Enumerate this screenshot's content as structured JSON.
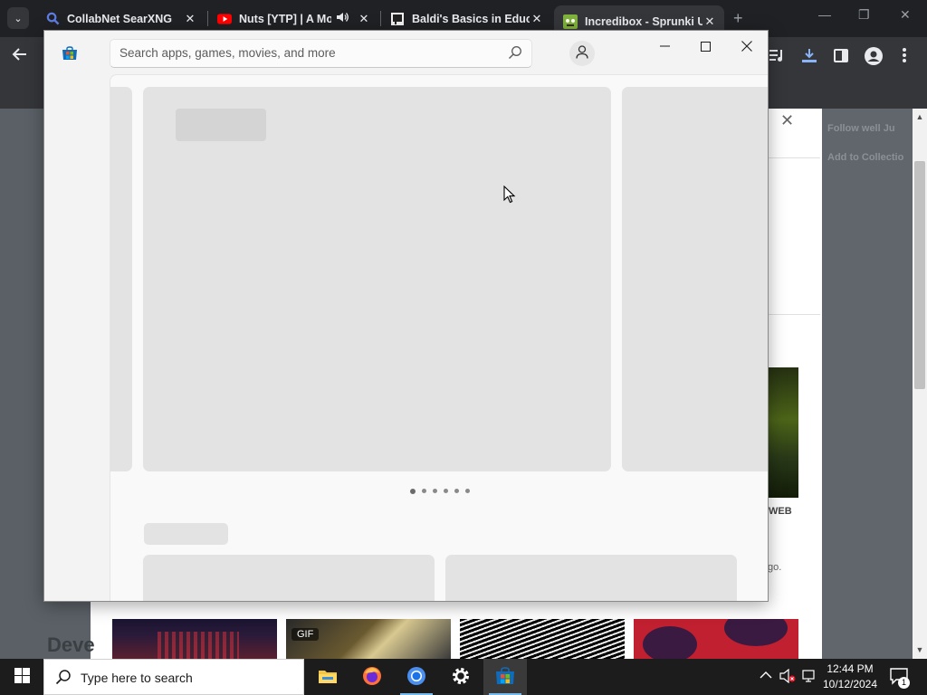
{
  "browser": {
    "tabs": [
      {
        "title": "CollabNet SearXNG",
        "favicon": "search-icon",
        "active": false
      },
      {
        "title": "Nuts [YTP] | A Mo",
        "favicon": "youtube-icon",
        "active": false,
        "audio": true
      },
      {
        "title": "Baldi's Basics in Educ",
        "favicon": "game-icon",
        "active": false
      },
      {
        "title": "Incredibox - Sprunki U",
        "favicon": "sprunki-icon",
        "active": true
      }
    ],
    "close_glyph": "✕",
    "new_tab_glyph": "+"
  },
  "page_behind": {
    "side_buttons": [
      "Follow well Ju",
      "Add to Collectio"
    ],
    "web_label": "WEB",
    "trailing_text": "go.",
    "section_heading": "Deve",
    "gif_badge": "GIF"
  },
  "store": {
    "search": {
      "placeholder": "Search apps, games, movies, and more",
      "value": ""
    },
    "carousel": {
      "total_dots": 6,
      "active_index": 0
    }
  },
  "taskbar": {
    "search_label": "Type here to search",
    "apps": [
      "file-explorer-icon",
      "firefox-icon",
      "chrome-icon",
      "settings-icon",
      "microsoft-store-icon"
    ],
    "clock": {
      "time": "12:44 PM",
      "date": "10/12/2024"
    },
    "notification_count": "1"
  }
}
